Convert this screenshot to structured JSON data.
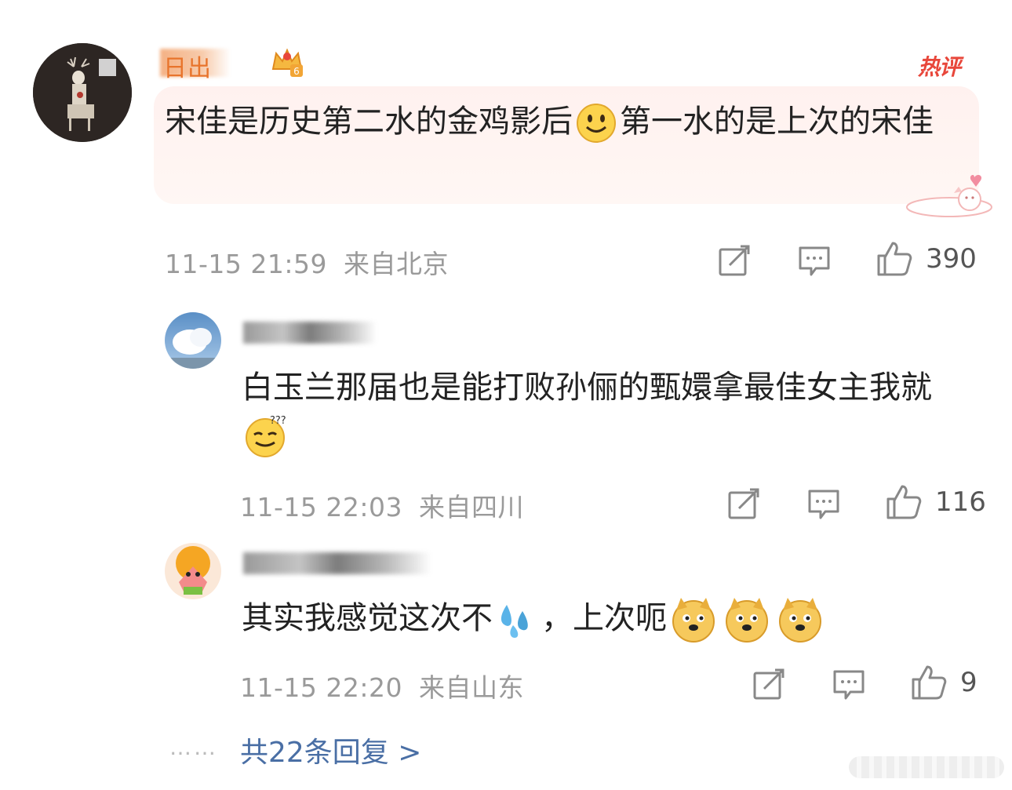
{
  "main_comment": {
    "username": "日出",
    "hot_label": "热评",
    "text_part1": "宋佳是历史第二水的金鸡影后",
    "text_part2": "第一水的是上次的宋佳",
    "time": "11-15 21:59",
    "location": "来自北京",
    "likes": "390"
  },
  "replies": [
    {
      "username": "",
      "text_part1": "白玉兰那届也是能打败孙俪的甄嬛拿最佳女主我就",
      "time": "11-15 22:03",
      "location": "来自四川",
      "likes": "116"
    },
    {
      "username": "",
      "text_part1": "其实我感觉这次不",
      "text_part2": "，上次呃",
      "time": "11-15 22:20",
      "location": "来自山东",
      "likes": "9"
    }
  ],
  "footer": {
    "dots": "……",
    "more_replies": "共22条回复 >"
  },
  "icons": {
    "repost": "repost-icon",
    "comment": "comment-icon",
    "like": "thumbs-up-icon"
  },
  "colors": {
    "username": "#e8742c",
    "hot": "#e8473b",
    "link": "#4a6fa5",
    "meta": "#9a9a9a"
  }
}
